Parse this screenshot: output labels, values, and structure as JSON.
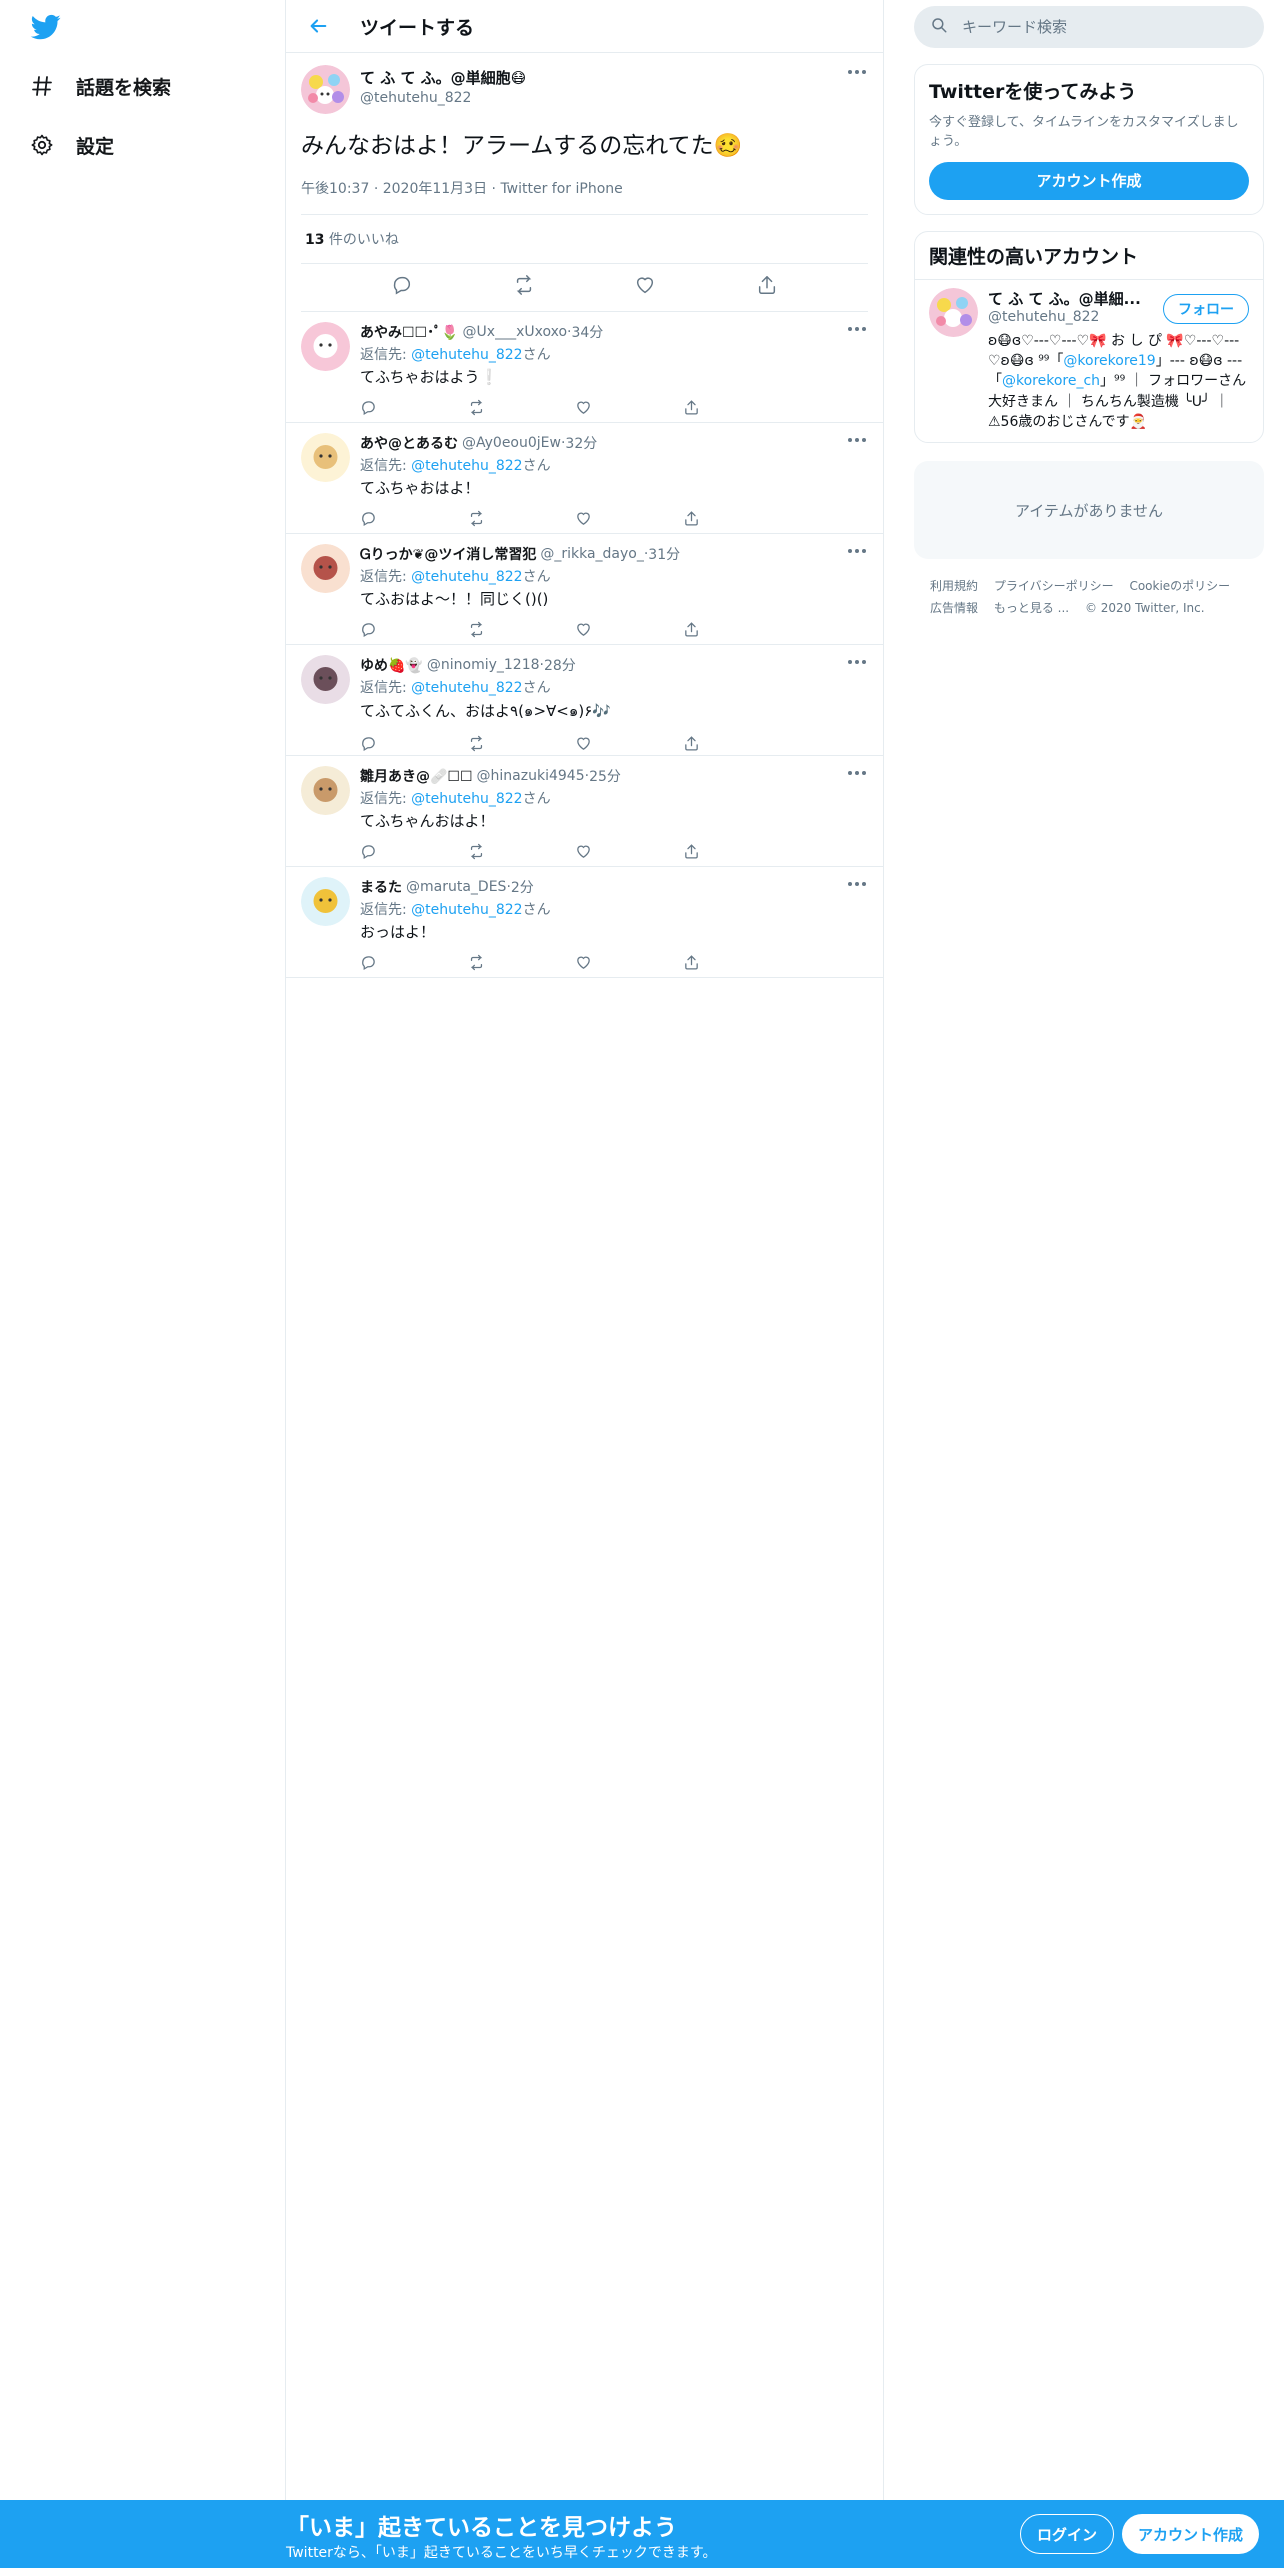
{
  "nav": {
    "logo": "twitter-bird-icon",
    "items": [
      {
        "label": "話題を検索",
        "icon": "hashtag-icon"
      },
      {
        "label": "設定",
        "icon": "gear-icon"
      }
    ]
  },
  "header": {
    "title": "ツイートする",
    "back_icon": "back-arrow-icon"
  },
  "focus_tweet": {
    "name": "て ふ て ふ。@単細胞😷",
    "handle": "@tehutehu_822",
    "text": "みんなおはよ！アラームするの忘れてた🥴",
    "time": "午後10:37",
    "date": "2020年11月3日",
    "source": "Twitter for iPhone",
    "likes_count": "13",
    "likes_label": " 件のいいね"
  },
  "replies": [
    {
      "name": "あやみ☐☐･ﾟ🌷",
      "handle": "@Ux___xUxoxo",
      "time": "34分",
      "reply_to_label": "返信先: ",
      "reply_to": "@tehutehu_822",
      "reply_suffix": "さん",
      "text": "てふちゃおはよう❕"
    },
    {
      "name": "あや@とあるむ",
      "handle": "@Ay0eou0jEw",
      "time": "32分",
      "reply_to_label": "返信先: ",
      "reply_to": "@tehutehu_822",
      "reply_suffix": "さん",
      "text": "てふちゃおはよ！"
    },
    {
      "name": "Ꮐりっか❦@ツイ消し常習犯",
      "handle": "@_rikka_dayo_",
      "time": "31分",
      "reply_to_label": "返信先: ",
      "reply_to": "@tehutehu_822",
      "reply_suffix": "さん",
      "text": "てふおはよ〜！！同じく()()"
    },
    {
      "name": "ゆめ🍓👻",
      "handle": "@ninomiy_1218",
      "time": "28分",
      "reply_to_label": "返信先: ",
      "reply_to": "@tehutehu_822",
      "reply_suffix": "さん",
      "text": "てふてふくん、おはよ٩(๑>∀<๑)۶🎶"
    },
    {
      "name": "雛月あき@🩹☐☐",
      "handle": "@hinazuki4945",
      "time": "25分",
      "reply_to_label": "返信先: ",
      "reply_to": "@tehutehu_822",
      "reply_suffix": "さん",
      "text": "てふちゃんおはよ！"
    },
    {
      "name": "まるた",
      "handle": "@maruta_DES",
      "time": "2分",
      "reply_to_label": "返信先: ",
      "reply_to": "@tehutehu_822",
      "reply_suffix": "さん",
      "text": "おっはよ！"
    }
  ],
  "sidebar": {
    "search_placeholder": "キーワード検索",
    "try_card": {
      "title": "Twitterを使ってみよう",
      "desc": "今すぐ登録して、タイムラインをカスタマイズしましょう。",
      "button": "アカウント作成"
    },
    "related": {
      "title": "関連性の高いアカウント",
      "name": "て ふ て ふ。@単細...",
      "handle": "@tehutehu_822",
      "follow_button": "フォロー",
      "bio_1": "ʚ😷ɞ♡---♡---♡🎀 お し ぴ 🎀♡---♡---♡ʚ😷ɞ ⁹⁹「",
      "bio_link_1": "@korekore19",
      "bio_2": "」--- ʚ😷ɞ --- 「",
      "bio_link_2": "@korekore_ch",
      "bio_3": "」⁹⁹ ｜ フォロワーさん大好きまん ｜ ちんちん製造機 ╰U╯ ｜ ⚠56歳のおじさんです🎅"
    },
    "no_items": "アイテムがありません",
    "footer_links": [
      "利用規約",
      "プライバシーポリシー",
      "Cookieのポリシー",
      "広告情報",
      "もっと見る ..."
    ],
    "copyright": "© 2020 Twitter, Inc."
  },
  "banner": {
    "headline": "「いま」起きていることを見つけよう",
    "sub": "Twitterなら、「いま」起きていることをいち早くチェックできます。",
    "login": "ログイン",
    "signup": "アカウント作成"
  },
  "colors": {
    "accent": "#1da1f2",
    "muted": "#657786",
    "border": "#e6ecf0"
  }
}
